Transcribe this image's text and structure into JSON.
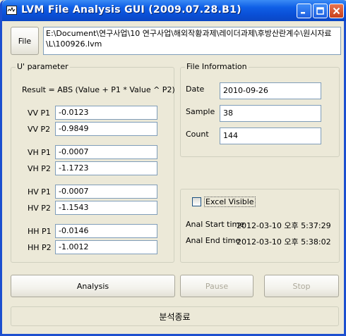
{
  "window": {
    "title": "LVM File Analysis GUI (2009.07.28.B1)"
  },
  "file": {
    "button_label": "File",
    "path": "E:\\Document\\연구사업\\10 연구사업\\해외작황과제\\레이더과제\\후방산란계수\\원시자료\\L\\100926.lvm"
  },
  "u_parameter": {
    "group_title": "U' parameter",
    "formula": "Result = ABS (Value + P1 * Value ^ P2)",
    "rows": [
      {
        "label": "VV P1",
        "value": "-0.0123"
      },
      {
        "label": "VV P2",
        "value": "-0.9849"
      },
      {
        "label": "VH P1",
        "value": "-0.0007"
      },
      {
        "label": "VH P2",
        "value": "-1.1723"
      },
      {
        "label": "HV P1",
        "value": "-0.0007"
      },
      {
        "label": "HV P2",
        "value": "-1.1543"
      },
      {
        "label": "HH P1",
        "value": "-0.0146"
      },
      {
        "label": "HH P2",
        "value": "-1.0012"
      }
    ]
  },
  "file_info": {
    "group_title": "File Information",
    "date_label": "Date",
    "date_value": "2010-09-26",
    "sample_label": "Sample",
    "sample_value": "38",
    "count_label": "Count",
    "count_value": "144"
  },
  "status_group": {
    "excel_visible_label": "Excel Visible",
    "excel_visible_checked": false,
    "start_label": "Anal Start time",
    "start_value": "2012-03-10 오후 5:37:29",
    "end_label": "Anal End time",
    "end_value": "2012-03-10 오후 5:38:02"
  },
  "actions": {
    "analysis": "Analysis",
    "pause": "Pause",
    "stop": "Stop"
  },
  "status_bar": {
    "text": "분석종료"
  },
  "colors": {
    "titlebar": "#0A4FD6",
    "window_bg": "#ECE9D8",
    "field_border": "#7F9DB9",
    "disabled_text": "#ACA899"
  }
}
